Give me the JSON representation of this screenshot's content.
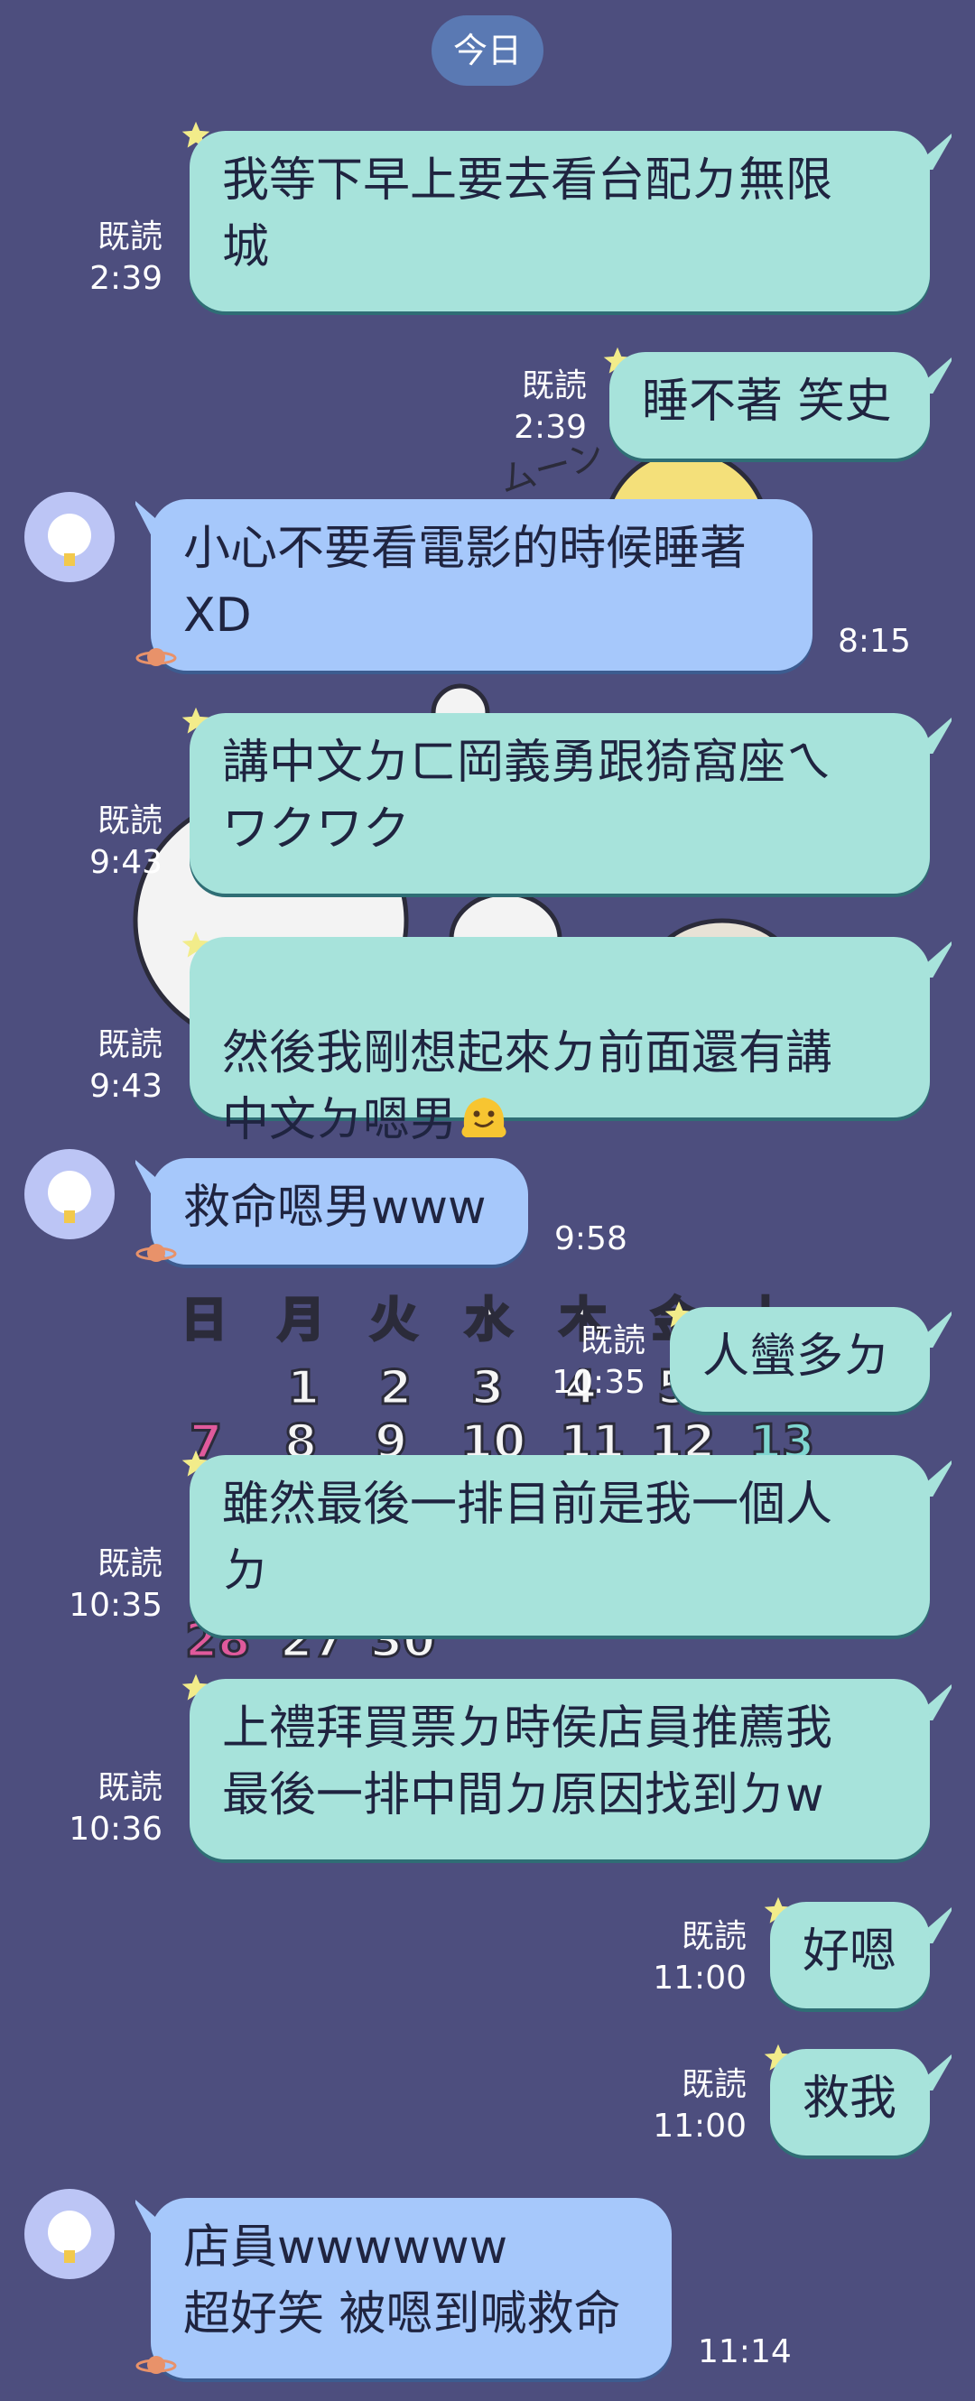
{
  "date_label": "今日",
  "messages": [
    {
      "dir": "out",
      "text": "我等下早上要去看台配ㄉ無限\n城",
      "read": "既読",
      "time": "2:39"
    },
    {
      "dir": "out",
      "text": "睡不著 笑史",
      "read": "既読",
      "time": "2:39"
    },
    {
      "dir": "in",
      "text": "小心不要看電影的時候睡著\nXD",
      "time": "8:15"
    },
    {
      "dir": "out",
      "text": "講中文ㄉㄈ岡義勇跟猗窩座ㄟ\nワクワク",
      "read": "既読",
      "time": "9:43"
    },
    {
      "dir": "out",
      "text": "然後我剛想起來ㄉ前面還有講\n中文ㄉ嗯男",
      "read": "既読",
      "time": "9:43",
      "emoji": "melting-face"
    },
    {
      "dir": "in",
      "text": "救命嗯男www",
      "time": "9:58"
    },
    {
      "dir": "out",
      "text": "人蠻多ㄉ",
      "read": "既読",
      "time": "10:35"
    },
    {
      "dir": "out",
      "text": "雖然最後一排目前是我一個人\nㄉ",
      "read": "既読",
      "time": "10:35"
    },
    {
      "dir": "out",
      "text": "上禮拜買票ㄉ時侯店員推薦我\n最後一排中間ㄉ原因找到ㄉw",
      "read": "既読",
      "time": "10:36"
    },
    {
      "dir": "out",
      "text": "好嗯",
      "read": "既読",
      "time": "11:00"
    },
    {
      "dir": "out",
      "text": "救我",
      "read": "既読",
      "time": "11:00"
    },
    {
      "dir": "in",
      "text": "店員wwwwww\n超好笑 被嗯到喊救命",
      "time": "11:14"
    }
  ],
  "background": {
    "calendar_weekdays": [
      "日",
      "月",
      "火",
      "水",
      "木",
      "金",
      "土"
    ],
    "calendar_numbers": [
      "1",
      "2",
      "3",
      "4",
      "5",
      "7",
      "8",
      "9",
      "10",
      "11",
      "12",
      "13",
      "28",
      "27",
      "30"
    ],
    "moon_text": "ムーン"
  },
  "colors": {
    "background": "#4d4e7e",
    "outgoing_bubble": "#a7e3db",
    "incoming_bubble": "#a6c8fb",
    "date_pill": "#5a79b3"
  }
}
